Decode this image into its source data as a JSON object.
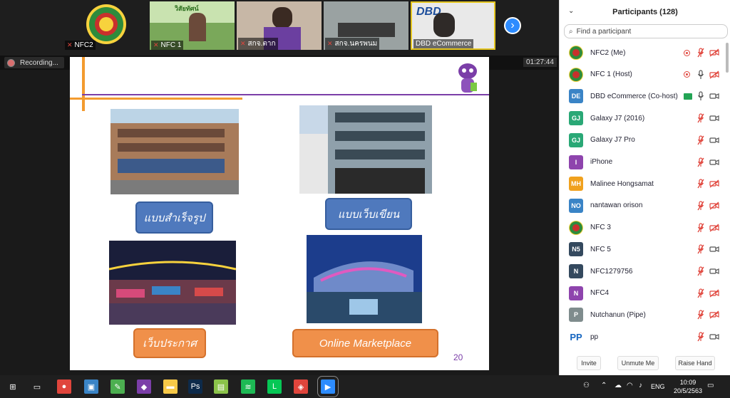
{
  "video_strip": {
    "tiles": [
      {
        "label": "NFC2"
      },
      {
        "label": "NFC 1"
      },
      {
        "label": "สกจ.ตาก"
      },
      {
        "label": "สกจ.นครพนม"
      },
      {
        "label": "DBD eCommerce"
      }
    ],
    "next_icon": "chevron-right-icon",
    "tile_thai_heading": "วิสัยทัศน์"
  },
  "recording": {
    "label": "Recording...",
    "timer": "01:27:44"
  },
  "slide": {
    "categories": [
      "แบบสำเร็จรูป",
      "แบบเว็บเขียน",
      "เว็บประกาศ",
      "Online Marketplace"
    ],
    "page_number": "20",
    "colors": {
      "orange": "#f39b2f",
      "purple": "#7b3ea8",
      "blue_button": "#4f79bd",
      "orange_button": "#f0904a"
    }
  },
  "participants": {
    "title": "Participants (128)",
    "search_placeholder": "Find a participant",
    "list": [
      {
        "initials": "",
        "name": "NFC2 (Me)",
        "avatar": "logo",
        "color": "#2e8b3c",
        "rec": true,
        "mic": "muted",
        "cam": "off"
      },
      {
        "initials": "",
        "name": "NFC 1 (Host)",
        "avatar": "logo",
        "color": "#2e8b3c",
        "rec": true,
        "mic": "on",
        "cam": "off"
      },
      {
        "initials": "DE",
        "name": "DBD eCommerce (Co-host)",
        "avatar": "text",
        "color": "#3a84c6",
        "share": true,
        "mic": "on",
        "cam": "on"
      },
      {
        "initials": "GJ",
        "name": "Galaxy J7 (2016)",
        "avatar": "text",
        "color": "#2aa876",
        "mic": "muted",
        "cam": "on"
      },
      {
        "initials": "GJ",
        "name": "Galaxy J7 Pro",
        "avatar": "text",
        "color": "#2aa876",
        "mic": "muted",
        "cam": "on"
      },
      {
        "initials": "I",
        "name": "iPhone",
        "avatar": "text",
        "color": "#8e44ad",
        "mic": "muted",
        "cam": "on"
      },
      {
        "initials": "MH",
        "name": "Malinee Hongsamat",
        "avatar": "text",
        "color": "#f0a11e",
        "mic": "muted",
        "cam": "off"
      },
      {
        "initials": "NO",
        "name": "nantawan orison",
        "avatar": "text",
        "color": "#3a84c6",
        "mic": "muted",
        "cam": "off"
      },
      {
        "initials": "",
        "name": "NFC 3",
        "avatar": "logo",
        "color": "#2e8b3c",
        "mic": "muted",
        "cam": "off"
      },
      {
        "initials": "N5",
        "name": "NFC 5",
        "avatar": "text",
        "color": "#34495e",
        "mic": "muted",
        "cam": "on"
      },
      {
        "initials": "N",
        "name": "NFC1279756",
        "avatar": "text",
        "color": "#34495e",
        "mic": "muted",
        "cam": "on"
      },
      {
        "initials": "N",
        "name": "NFC4",
        "avatar": "text",
        "color": "#8e44ad",
        "mic": "muted",
        "cam": "off"
      },
      {
        "initials": "P",
        "name": "Nutchanun (Pipe)",
        "avatar": "text",
        "color": "#7f8c8d",
        "mic": "muted",
        "cam": "off"
      },
      {
        "initials": "",
        "name": "pp",
        "avatar": "pp-logo",
        "color": "#1565c0",
        "mic": "muted",
        "cam": "on"
      }
    ],
    "buttons": {
      "invite": "Invite",
      "unmute_me": "Unmute Me",
      "raise_hand": "Raise Hand"
    }
  },
  "taskbar": {
    "lang": "ENG",
    "time": "10:09",
    "date": "20/5/2563",
    "icons": [
      "windows-start-icon",
      "task-view-icon",
      "chrome-icon",
      "network-app-icon",
      "notepad-icon",
      "visual-studio-icon",
      "file-explorer-icon",
      "photoshop-icon",
      "notes-icon",
      "spotify-icon",
      "line-icon",
      "anydesk-icon",
      "zoom-icon"
    ]
  }
}
